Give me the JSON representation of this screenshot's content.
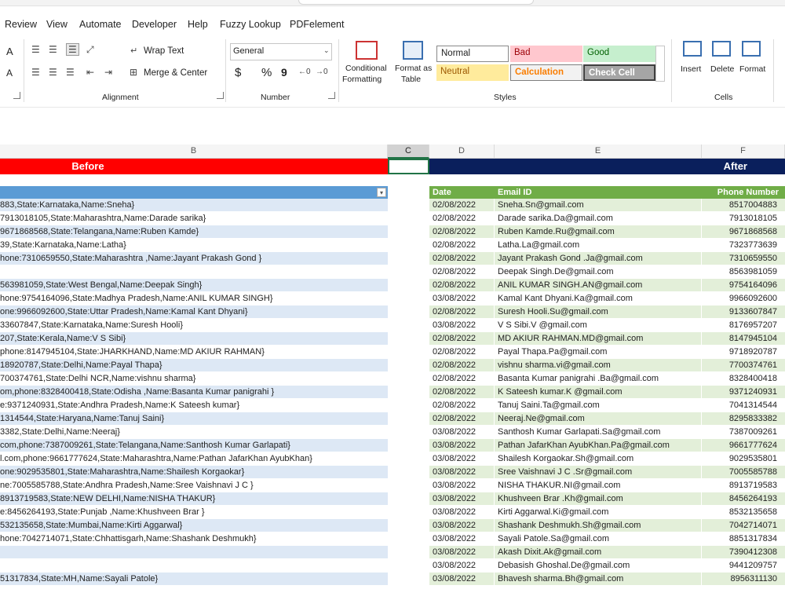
{
  "menu": [
    "Review",
    "View",
    "Automate",
    "Developer",
    "Help",
    "Fuzzy Lookup",
    "PDFelement"
  ],
  "ribbon": {
    "font_partial": {
      "a_up": "A",
      "a_down": "A"
    },
    "alignment": {
      "wrap_text": "Wrap Text",
      "merge_center": "Merge & Center",
      "label": "Alignment"
    },
    "number": {
      "format": "General",
      "currency": "$",
      "percent": "%",
      "comma": "9",
      "label": "Number"
    },
    "styles": {
      "conditional": "Conditional",
      "formatting": "Formatting",
      "format_as": "Format as",
      "table": "Table",
      "normal": "Normal",
      "bad": "Bad",
      "good": "Good",
      "neutral": "Neutral",
      "calculation": "Calculation",
      "check_cell": "Check Cell",
      "label": "Styles"
    },
    "cells": {
      "insert": "Insert",
      "delete": "Delete",
      "format": "Format",
      "label": "Cells"
    }
  },
  "columns": {
    "B": "B",
    "C": "C",
    "D": "D",
    "E": "E",
    "F": "F"
  },
  "headers": {
    "before": "Before",
    "after": "After",
    "date": "Date",
    "email": "Email ID",
    "phone": "Phone Number"
  },
  "colors": {
    "red": "#ff0000",
    "navy": "#0a1f5c",
    "green_header": "#70ad47",
    "blue_header": "#5b9bd5"
  },
  "rows": [
    {
      "b": "883,State:Karnataka,Name:Sneha}",
      "d": "02/08/2022",
      "e": "Sneha.Sn@gmail.com",
      "f": "8517004883"
    },
    {
      "b": "7913018105,State:Maharashtra,Name:Darade sarika}",
      "d": "02/08/2022",
      "e": "Darade sarika.Da@gmail.com",
      "f": "7913018105"
    },
    {
      "b": "9671868568,State:Telangana,Name:Ruben Kamde}",
      "d": "02/08/2022",
      "e": "Ruben Kamde.Ru@gmail.com",
      "f": "9671868568"
    },
    {
      "b": "39,State:Karnataka,Name:Latha}",
      "d": "02/08/2022",
      "e": "Latha.La@gmail.com",
      "f": "7323773639"
    },
    {
      "b": "hone:7310659550,State:Maharashtra ,Name:Jayant Prakash Gond }",
      "d": "02/08/2022",
      "e": "Jayant Prakash Gond .Ja@gmail.com",
      "f": "7310659550"
    },
    {
      "b": "",
      "d": "02/08/2022",
      "e": "Deepak Singh.De@gmail.com",
      "f": "8563981059"
    },
    {
      "b": "563981059,State:West Bengal,Name:Deepak Singh}",
      "d": "02/08/2022",
      "e": "ANIL KUMAR SINGH.AN@gmail.com",
      "f": "9754164096"
    },
    {
      "b": "hone:9754164096,State:Madhya Pradesh,Name:ANIL KUMAR SINGH}",
      "d": "03/08/2022",
      "e": "Kamal Kant Dhyani.Ka@gmail.com",
      "f": "9966092600"
    },
    {
      "b": "one:9966092600,State:Uttar Pradesh,Name:Kamal Kant Dhyani}",
      "d": "02/08/2022",
      "e": "Suresh Hooli.Su@gmail.com",
      "f": "9133607847"
    },
    {
      "b": "33607847,State:Karnataka,Name:Suresh Hooli}",
      "d": "03/08/2022",
      "e": "V S Sibi.V @gmail.com",
      "f": "8176957207"
    },
    {
      "b": "207,State:Kerala,Name:V S Sibi}",
      "d": "02/08/2022",
      "e": "MD AKIUR RAHMAN.MD@gmail.com",
      "f": "8147945104"
    },
    {
      "b": "phone:8147945104,State:JHARKHAND,Name:MD AKIUR RAHMAN}",
      "d": "02/08/2022",
      "e": "Payal Thapa.Pa@gmail.com",
      "f": "9718920787"
    },
    {
      "b": "18920787,State:Delhi,Name:Payal Thapa}",
      "d": "02/08/2022",
      "e": "vishnu sharma.vi@gmail.com",
      "f": "7700374761"
    },
    {
      "b": "700374761,State:Delhi NCR,Name:vishnu sharma}",
      "d": "02/08/2022",
      "e": "Basanta Kumar panigrahi .Ba@gmail.com",
      "f": "8328400418"
    },
    {
      "b": "om,phone:8328400418,State:Odisha ,Name:Basanta Kumar panigrahi }",
      "d": "02/08/2022",
      "e": "K Sateesh kumar.K @gmail.com",
      "f": "9371240931"
    },
    {
      "b": "e:9371240931,State:Andhra Pradesh,Name:K Sateesh kumar}",
      "d": "02/08/2022",
      "e": "Tanuj Saini.Ta@gmail.com",
      "f": "7041314544"
    },
    {
      "b": "1314544,State:Haryana,Name:Tanuj Saini}",
      "d": "02/08/2022",
      "e": "Neeraj.Ne@gmail.com",
      "f": "8295833382"
    },
    {
      "b": "3382,State:Delhi,Name:Neeraj}",
      "d": "03/08/2022",
      "e": "Santhosh Kumar Garlapati.Sa@gmail.com",
      "f": "7387009261"
    },
    {
      "b": "com,phone:7387009261,State:Telangana,Name:Santhosh Kumar Garlapati}",
      "d": "03/08/2022",
      "e": "Pathan JafarKhan AyubKhan.Pa@gmail.com",
      "f": "9661777624"
    },
    {
      "b": "l.com,phone:9661777624,State:Maharashtra,Name:Pathan JafarKhan AyubKhan}",
      "d": "03/08/2022",
      "e": "Shailesh Korgaokar.Sh@gmail.com",
      "f": "9029535801"
    },
    {
      "b": "one:9029535801,State:Maharashtra,Name:Shailesh Korgaokar}",
      "d": "03/08/2022",
      "e": "Sree Vaishnavi J C .Sr@gmail.com",
      "f": "7005585788"
    },
    {
      "b": "ne:7005585788,State:Andhra Pradesh,Name:Sree Vaishnavi J C }",
      "d": "03/08/2022",
      "e": "NISHA THAKUR.NI@gmail.com",
      "f": "8913719583"
    },
    {
      "b": "8913719583,State:NEW DELHI,Name:NISHA THAKUR}",
      "d": "03/08/2022",
      "e": "Khushveen Brar .Kh@gmail.com",
      "f": "8456264193"
    },
    {
      "b": "e:8456264193,State:Punjab ,Name:Khushveen Brar }",
      "d": "03/08/2022",
      "e": "Kirti Aggarwal.Ki@gmail.com",
      "f": "8532135658"
    },
    {
      "b": "532135658,State:Mumbai,Name:Kirti Aggarwal}",
      "d": "03/08/2022",
      "e": "Shashank Deshmukh.Sh@gmail.com",
      "f": "7042714071"
    },
    {
      "b": "hone:7042714071,State:Chhattisgarh,Name:Shashank Deshmukh}",
      "d": "03/08/2022",
      "e": "Sayali Patole.Sa@gmail.com",
      "f": "8851317834"
    },
    {
      "b": "",
      "d": "03/08/2022",
      "e": "Akash Dixit.Ak@gmail.com",
      "f": "7390412308"
    },
    {
      "b": "",
      "d": "03/08/2022",
      "e": "Debasish Ghoshal.De@gmail.com",
      "f": "9441209757"
    },
    {
      "b": "51317834,State:MH,Name:Sayali Patole}",
      "d": "03/08/2022",
      "e": "Bhavesh sharma.Bh@gmail.com",
      "f": "8956311130"
    }
  ]
}
